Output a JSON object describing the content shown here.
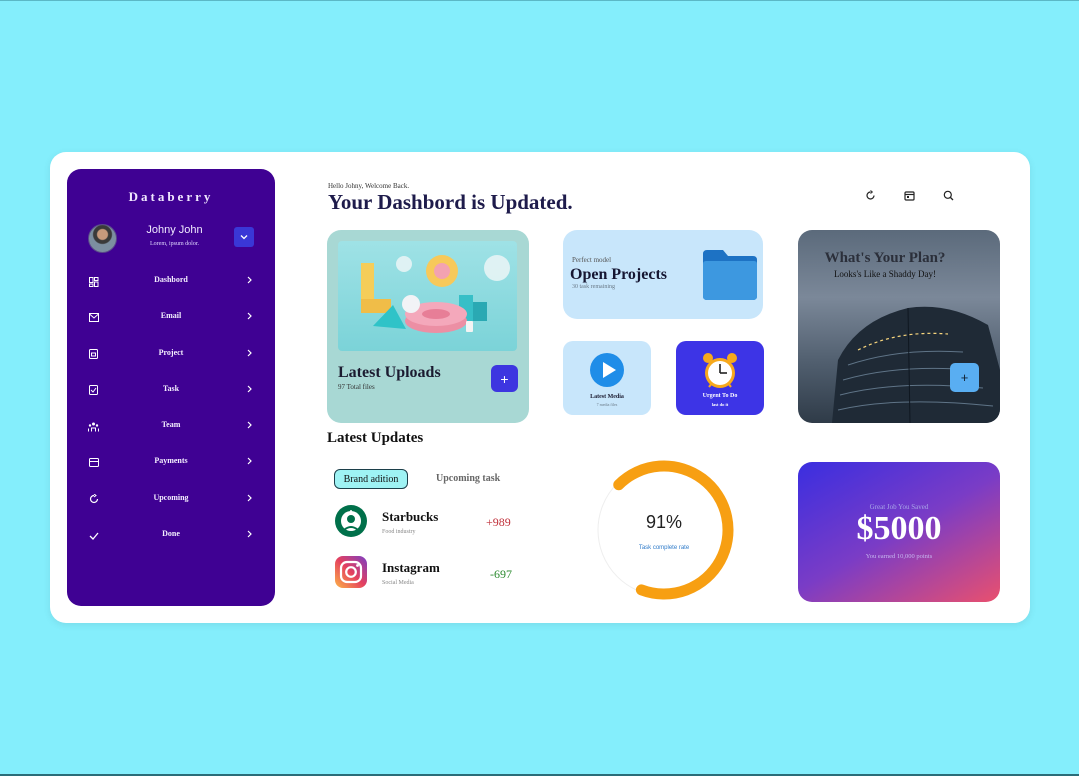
{
  "sidebar": {
    "brand": "Databerry",
    "user": {
      "name": "Johny John",
      "subtitle": "Lorem, ipsum dolor."
    },
    "items": [
      {
        "label": "Dashbord",
        "icon": "dashboard-icon"
      },
      {
        "label": "Email",
        "icon": "mail-icon"
      },
      {
        "label": "Project",
        "icon": "project-icon"
      },
      {
        "label": "Task",
        "icon": "task-check-icon"
      },
      {
        "label": "Team",
        "icon": "team-icon"
      },
      {
        "label": "Payments",
        "icon": "payment-card-icon"
      },
      {
        "label": "Upcoming",
        "icon": "upcoming-refresh-icon"
      },
      {
        "label": "Done",
        "icon": "done-check-icon"
      }
    ]
  },
  "header": {
    "greeting": "Hello Johny, Welcome Back.",
    "title": "Your Dashbord is Updated.",
    "icons": [
      "refresh-icon",
      "calendar-icon",
      "search-icon"
    ]
  },
  "uploads": {
    "title": "Latest Uploads",
    "subtitle": "97 Total files",
    "add_label": "+"
  },
  "projects": {
    "kicker": "Perfect model",
    "title": "Open Projects",
    "subtitle": "30 task remaining"
  },
  "media": {
    "label": "Latest Media",
    "subtitle": "7 media files"
  },
  "urgent": {
    "label": "Urgent To Do",
    "subtitle": "last do it"
  },
  "plan": {
    "title": "What's Your Plan?",
    "subtitle": "Looks's Like a Shaddy Day!",
    "add_label": "+"
  },
  "updates": {
    "title": "Latest Updates",
    "tabs": [
      "Brand adition",
      "Upcoming task"
    ],
    "rows": [
      {
        "name": "Starbucks",
        "category": "Food industry",
        "value": "+989",
        "color": "#c0303a"
      },
      {
        "name": "Instagram",
        "category": "Social Media",
        "value": "-697",
        "color": "#2a8a2e"
      }
    ]
  },
  "progress": {
    "value_text": "91%",
    "value": 0.91,
    "label": "Task complete rate",
    "color": "#f79f12"
  },
  "savings": {
    "kicker": "Great Job You Saved",
    "amount": "$5000",
    "subtitle": "You earned 10,000 points"
  },
  "colors": {
    "sidebar": "#3f0193",
    "accent": "#3d36e0",
    "background": "#84eefc"
  }
}
